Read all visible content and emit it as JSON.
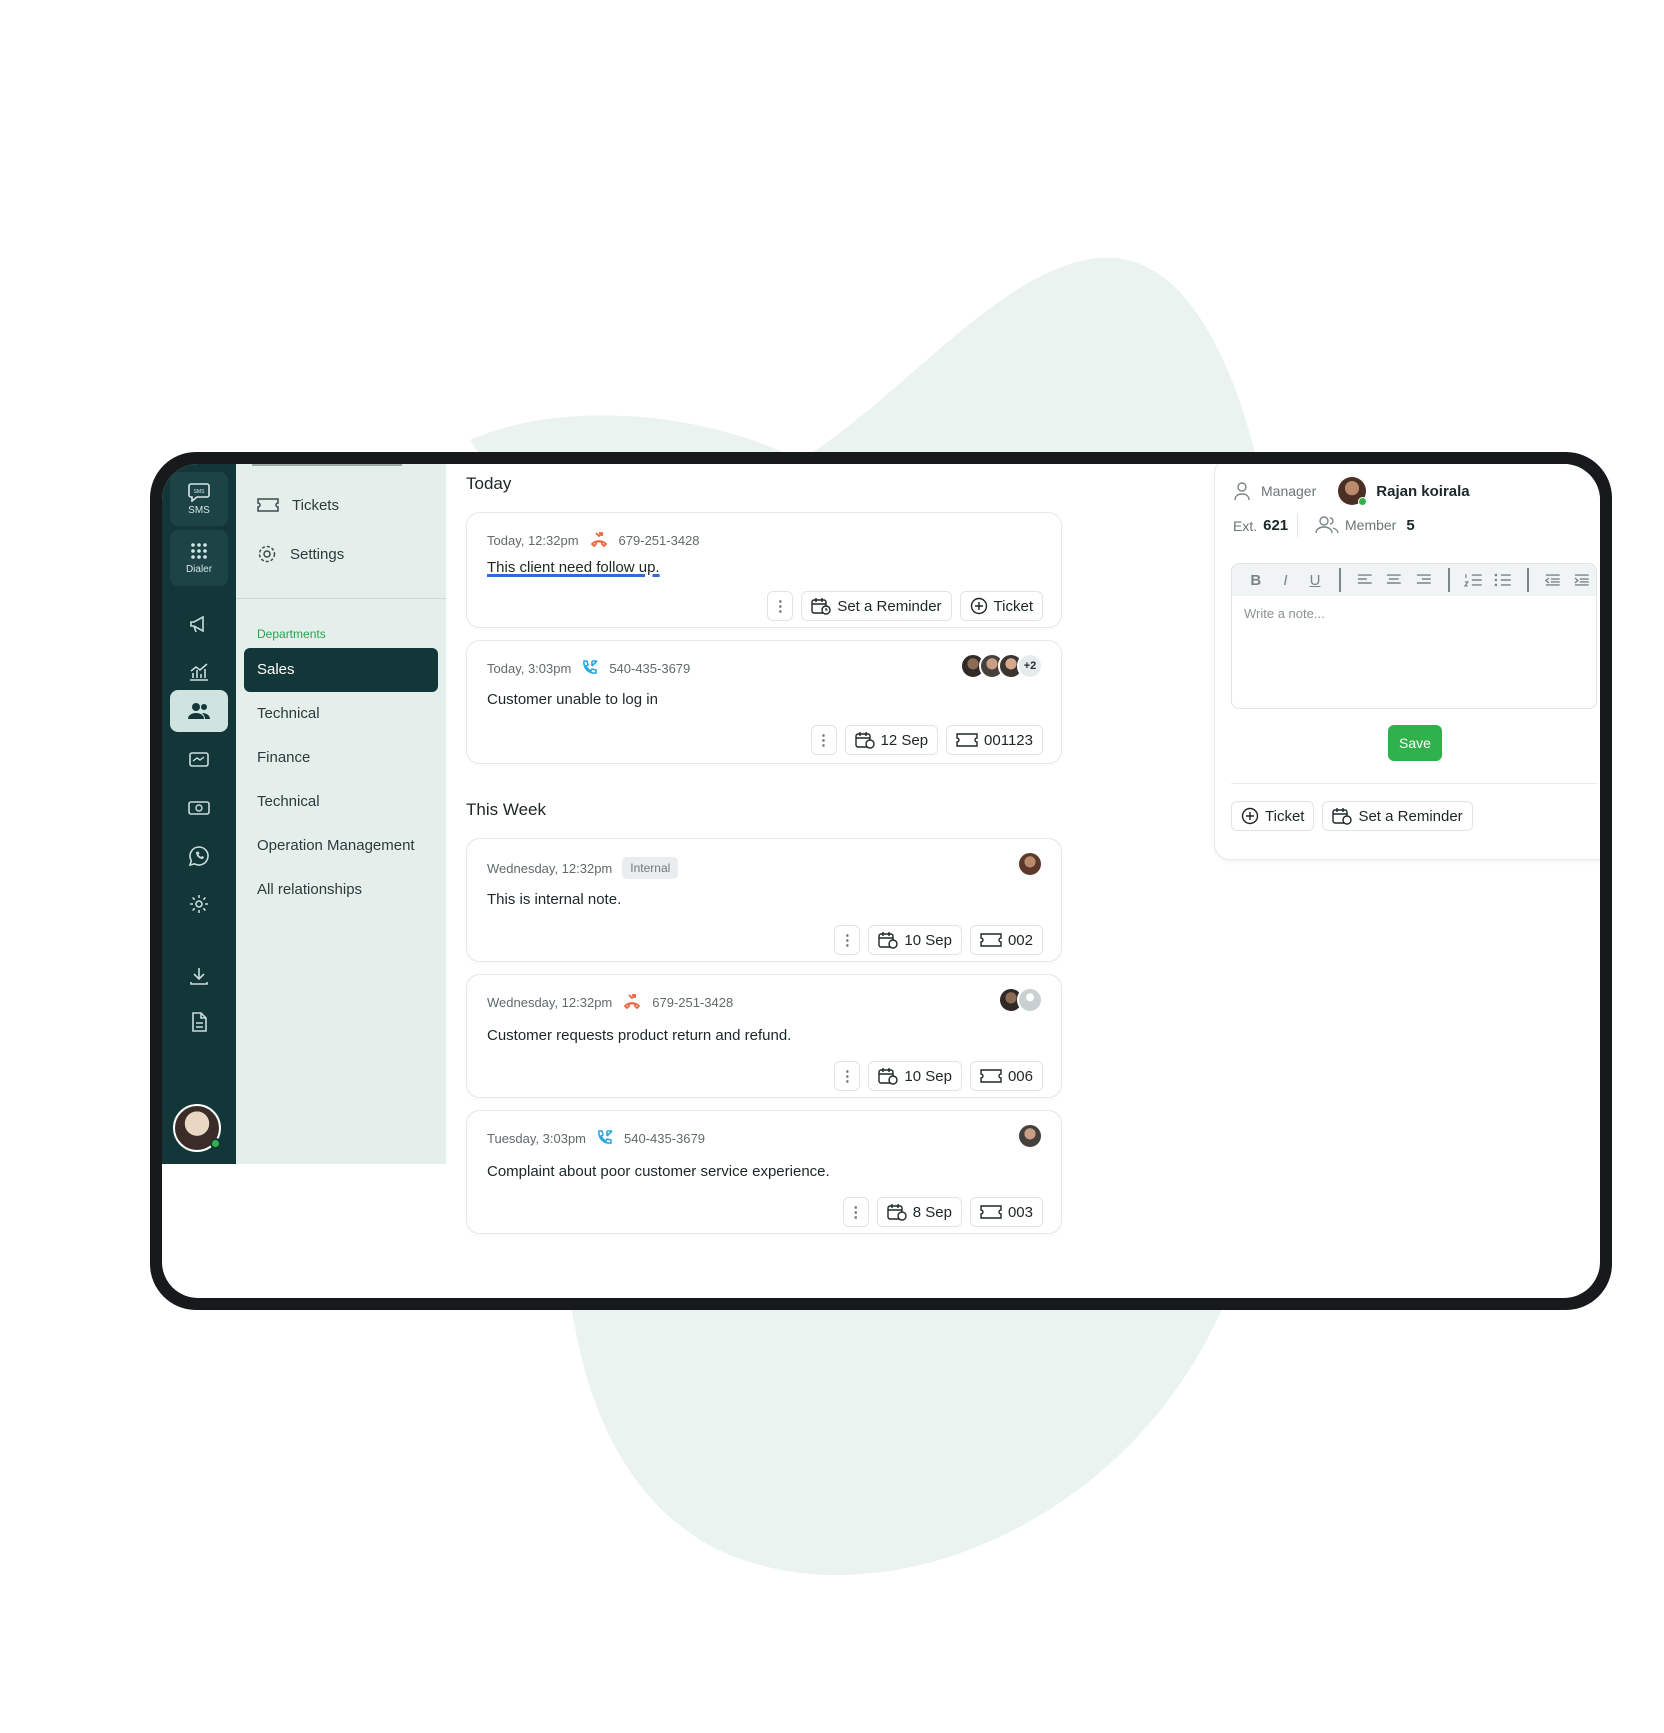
{
  "rail": {
    "sms_label": "SMS",
    "dialer_label": "Dialer"
  },
  "sidebar": {
    "links": [
      {
        "label": "Tickets",
        "icon": "ticket-icon"
      },
      {
        "label": "Settings",
        "icon": "gear-icon"
      }
    ],
    "departments_label": "Departments",
    "departments": [
      "Sales",
      "Technical",
      "Finance",
      "Technical",
      "Operation Management",
      "All relationships"
    ],
    "active_department": "Sales"
  },
  "feed": {
    "today_title": "Today",
    "week_title": "This Week",
    "cards": [
      {
        "time": "Today, 12:32pm",
        "call_type": "missed",
        "phone": "679-251-3428",
        "note": "This client need follow up.",
        "reminder_label": "Set a Reminder",
        "ticket_label": "Ticket"
      },
      {
        "time": "Today, 3:03pm",
        "call_type": "incoming",
        "phone": "540-435-3679",
        "note": "Customer unable to log in",
        "extra_count": "+2",
        "date": "12 Sep",
        "ticket_id": "001123"
      },
      {
        "time": "Wednesday, 12:32pm",
        "tag": "Internal",
        "note": "This is internal note.",
        "date": "10 Sep",
        "ticket_id": "002"
      },
      {
        "time": "Wednesday, 12:32pm",
        "call_type": "missed",
        "phone": "679-251-3428",
        "note": "Customer requests product return and refund.",
        "date": "10 Sep",
        "ticket_id": "006"
      },
      {
        "time": "Tuesday, 3:03pm",
        "call_type": "incoming",
        "phone": "540-435-3679",
        "note": "Complaint about poor customer service experience.",
        "date": "8 Sep",
        "ticket_id": "003"
      }
    ]
  },
  "panel": {
    "manager_label": "Manager",
    "manager_name": "Rajan koirala",
    "ext_label": "Ext.",
    "ext_value": "621",
    "member_label": "Member",
    "member_value": "5",
    "toolbar_buttons": [
      "B",
      "I",
      "U"
    ],
    "note_placeholder": "Write a note...",
    "save_label": "Save",
    "ticket_label": "Ticket",
    "reminder_label": "Set a Reminder"
  },
  "colors": {
    "rail_bg": "#133638",
    "sidebar_bg": "#e4efec",
    "accent_green": "#2fb24c",
    "missed_call": "#f0643c",
    "incoming_call": "#2aa8e0",
    "blob": "#e8f1ee"
  }
}
